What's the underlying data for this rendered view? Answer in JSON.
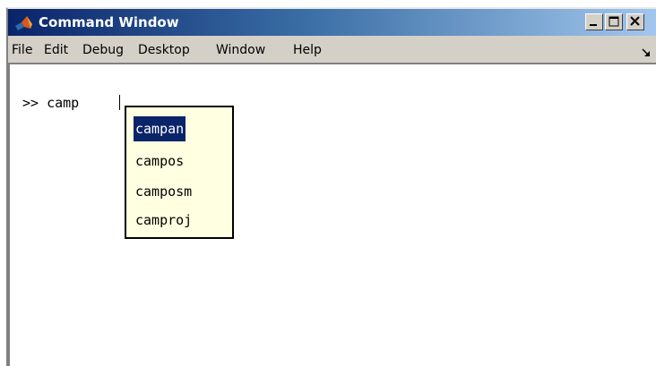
{
  "window": {
    "title": "Command Window"
  },
  "menu": {
    "items": [
      "File",
      "Edit",
      "Debug",
      "Desktop",
      "Window",
      "Help"
    ]
  },
  "command": {
    "prompt": ">>",
    "input": "camp"
  },
  "completion": {
    "items": [
      "campan",
      "campos",
      "camposm",
      "camproj"
    ],
    "selected": "campan"
  },
  "colors": {
    "title_start": "#0a246a",
    "title_end": "#a6caf0",
    "selection": "#0a246a",
    "popup_bg": "#ffffe1"
  },
  "icons": [
    "matlab-logo-icon",
    "minimize-icon",
    "maximize-icon",
    "close-icon",
    "dock-arrow-icon"
  ]
}
